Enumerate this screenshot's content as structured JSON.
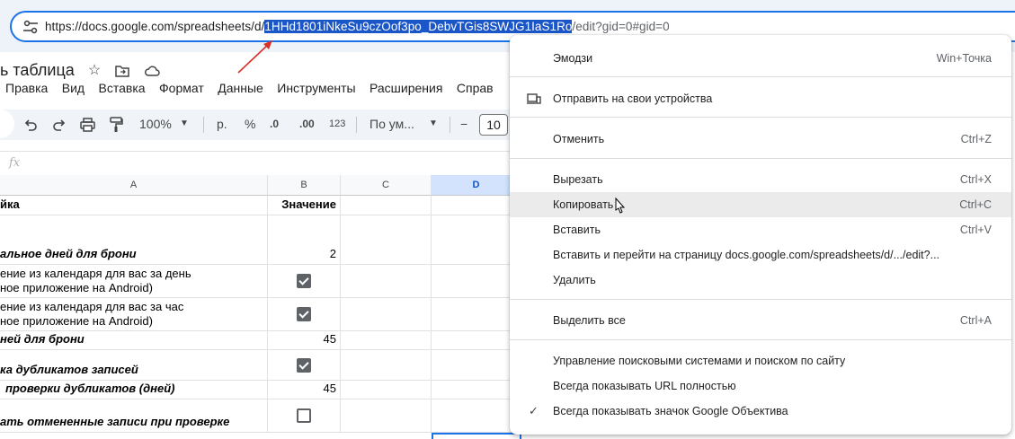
{
  "browser": {
    "url_prefix": "https://docs.google.com/spreadsheets/d/",
    "url_selected": "1HHd1801iNkeSu9czOof3po_DebvTGis8SWJG1IaS1Ro",
    "url_suffix": "/edit?gid=0#gid=0"
  },
  "sheet": {
    "title": "ь таблица",
    "menu": [
      "Правка",
      "Вид",
      "Вставка",
      "Формат",
      "Данные",
      "Инструменты",
      "Расширения",
      "Справ"
    ],
    "toolbar": {
      "zoom": "100%",
      "currency": "р.",
      "percent": "%",
      "dec_decrease": ".0",
      "dec_increase": ".00",
      "number_format": "123",
      "font": "По ум...",
      "minus": "−",
      "font_size": "10"
    },
    "formula_label": "fx",
    "columns": [
      "A",
      "B",
      "C",
      "D"
    ],
    "rows": [
      {
        "a": "йка",
        "b": "Значение",
        "type": "header"
      },
      {
        "a": "",
        "b": "",
        "type": "blank"
      },
      {
        "a": "альное дней для брони",
        "b": "2",
        "type": "num"
      },
      {
        "a": "ение из календаря для вас за день\nное приложение на Android)",
        "b": true,
        "type": "check"
      },
      {
        "a": "ение из календаря для вас за час\nное приложение на Android)",
        "b": true,
        "type": "check"
      },
      {
        "a": "ней для брони",
        "b": "45",
        "type": "num"
      },
      {
        "a": "ка дубликатов записей",
        "b": true,
        "type": "check"
      },
      {
        "a": "проверки дубликатов (дней)",
        "b": "45",
        "type": "num"
      },
      {
        "a": "ать отмененные записи при проверке",
        "b": false,
        "type": "check"
      }
    ]
  },
  "context_menu": {
    "items": [
      {
        "label": "Эмодзи",
        "shortcut": "Win+Точка"
      },
      {
        "label": "Отправить на свои устройства",
        "shortcut": "",
        "icon": "send-to-devices-icon"
      },
      {
        "label": "Отменить",
        "shortcut": "Ctrl+Z"
      },
      {
        "label": "Вырезать",
        "shortcut": "Ctrl+X"
      },
      {
        "label": "Копировать",
        "shortcut": "Ctrl+C"
      },
      {
        "label": "Вставить",
        "shortcut": "Ctrl+V"
      },
      {
        "label": "Вставить и перейти на страницу docs.google.com/spreadsheets/d/.../edit?...",
        "shortcut": ""
      },
      {
        "label": "Удалить",
        "shortcut": ""
      },
      {
        "label": "Выделить все",
        "shortcut": "Ctrl+A"
      },
      {
        "label": "Управление поисковыми системами и поиском по сайту",
        "shortcut": ""
      },
      {
        "label": "Всегда показывать URL полностью",
        "shortcut": ""
      },
      {
        "label": "Всегда показывать значок Google Объектива",
        "shortcut": "",
        "checked": "✓"
      }
    ]
  }
}
